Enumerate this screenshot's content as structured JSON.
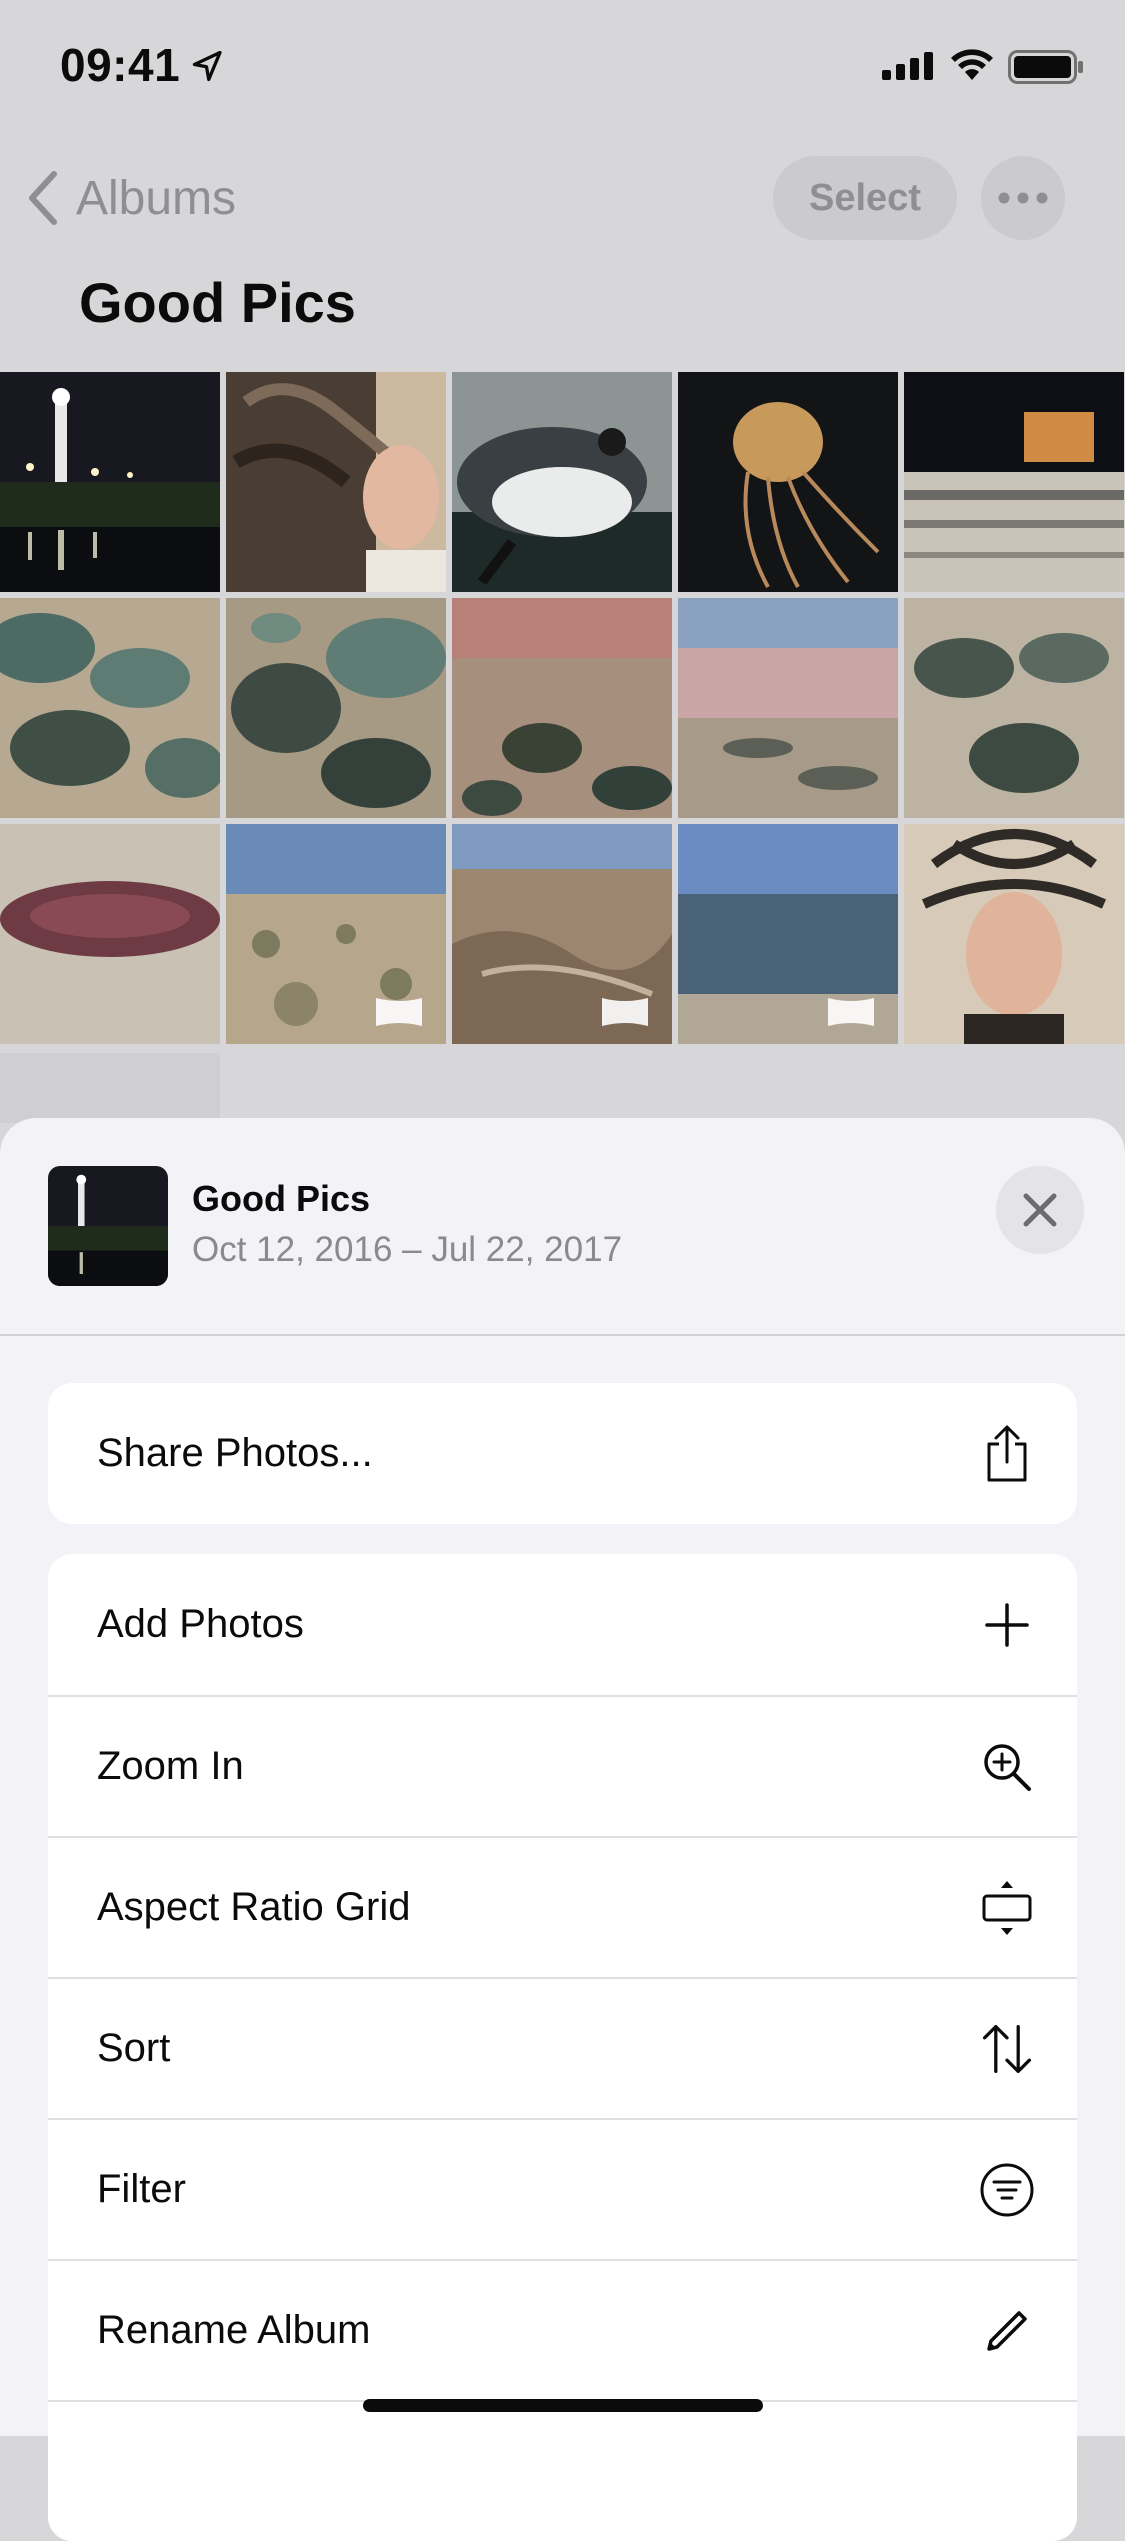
{
  "status_bar": {
    "time": "09:41",
    "icons": [
      "location-arrow-icon",
      "cellular-signal-icon",
      "wifi-icon",
      "battery-icon"
    ]
  },
  "nav": {
    "back_label": "Albums",
    "select_label": "Select",
    "more_icon": "ellipsis-icon",
    "title": "Good Pics"
  },
  "photos": [
    {
      "name": "lighthouse-night",
      "video": false
    },
    {
      "name": "robot-mannequin",
      "video": false
    },
    {
      "name": "penguin-swimming",
      "video": false
    },
    {
      "name": "jellyfish",
      "video": false
    },
    {
      "name": "ship-night",
      "video": false
    },
    {
      "name": "tide-pools-1",
      "video": false
    },
    {
      "name": "tide-pools-2",
      "video": false
    },
    {
      "name": "red-tide-pools",
      "video": false
    },
    {
      "name": "pink-salt-flat",
      "video": false
    },
    {
      "name": "tide-pools-3",
      "video": false
    },
    {
      "name": "dry-red-pond",
      "video": false
    },
    {
      "name": "desert-shrubs",
      "video": true
    },
    {
      "name": "desert-canyon",
      "video": true
    },
    {
      "name": "desert-lake-view",
      "video": true
    },
    {
      "name": "mannequin-wires",
      "video": false
    }
  ],
  "sheet": {
    "album_name": "Good Pics",
    "album_dates": "Oct 12, 2016 – Jul 22, 2017",
    "close_icon": "close-icon",
    "share_label": "Share Photos...",
    "items": [
      {
        "label": "Add Photos",
        "icon": "plus-icon"
      },
      {
        "label": "Zoom In",
        "icon": "zoom-in-icon"
      },
      {
        "label": "Aspect Ratio Grid",
        "icon": "aspect-ratio-icon"
      },
      {
        "label": "Sort",
        "icon": "sort-arrows-icon"
      },
      {
        "label": "Filter",
        "icon": "filter-icon"
      },
      {
        "label": "Rename Album",
        "icon": "pencil-icon"
      }
    ]
  },
  "colors": {
    "backdrop": "#d7d7d9",
    "sheet_bg": "#f2f2f7",
    "secondary_text": "#8a8a8e"
  }
}
